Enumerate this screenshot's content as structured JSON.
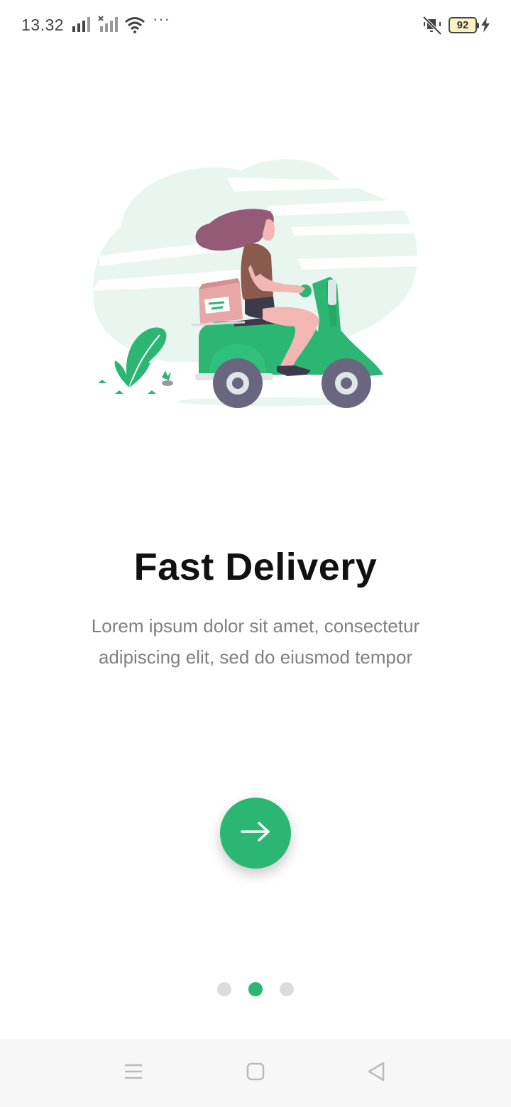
{
  "status_bar": {
    "time": "13.32",
    "battery": "92",
    "icons": [
      "signal-icon",
      "signal-x-icon",
      "wifi-icon",
      "more-dots-icon",
      "mute-icon",
      "battery-icon",
      "charging-icon"
    ]
  },
  "onboarding": {
    "title": "Fast Delivery",
    "description": "Lorem ipsum dolor sit amet, consectetur adipiscing elit, sed do eiusmod tempor",
    "next_icon": "arrow-right-icon",
    "illustration": "scooter-delivery-illustration",
    "page_indicator": {
      "total": 3,
      "active": 2
    }
  },
  "colors": {
    "accent": "#2bb673",
    "title": "#111111",
    "body_text": "#808080",
    "inactive_dot": "#dcdcdc"
  },
  "nav_bar": {
    "icons": [
      "menu-icon",
      "home-square-icon",
      "back-triangle-icon"
    ]
  }
}
